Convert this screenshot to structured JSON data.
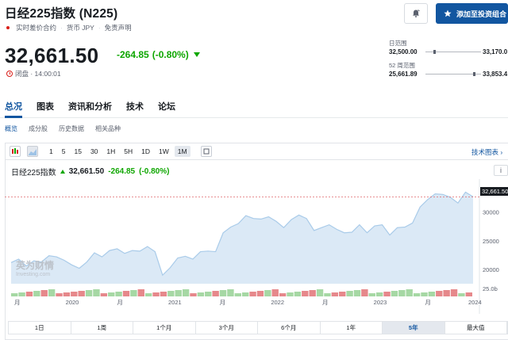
{
  "header": {
    "title": "日经225指数 (N225)",
    "meta": [
      "实时差价合约",
      "货币 JPY",
      "免责声明"
    ],
    "add_button": "添加至投资组合",
    "price": "32,661.50",
    "change": "-264.85",
    "change_pct": "(-0.80%)",
    "status": "闭盘 · 14:00:01"
  },
  "ranges": {
    "day_label": "日范围",
    "day_low": "32,500.00",
    "day_high": "33,170.0",
    "wk52_label": "52 周范围",
    "wk52_low": "25,661.89",
    "wk52_high": "33,853.4"
  },
  "tabs": [
    "总况",
    "图表",
    "资讯和分析",
    "技术",
    "论坛"
  ],
  "subtabs": [
    "概览",
    "成分股",
    "历史数据",
    "相关品种"
  ],
  "toolbar": {
    "intervals": [
      "1",
      "5",
      "15",
      "30",
      "1H",
      "5H",
      "1D",
      "1W",
      "1M"
    ],
    "active_interval": "1M",
    "tech_link": "技术图表 ›"
  },
  "chart_legend": {
    "name": "日经225指数",
    "value": "32,661.50",
    "change": "-264.85",
    "change_pct": "(-0.80%)"
  },
  "watermark": {
    "main": "英为财情",
    "sub": "Investing.com"
  },
  "price_tag": "32,661.50",
  "periods": [
    "1日",
    "1周",
    "1个月",
    "3个月",
    "6个月",
    "1年",
    "5年",
    "最大值"
  ],
  "active_period": "5年",
  "chart_data": {
    "type": "area",
    "series": [
      {
        "values": [
          21200,
          21800,
          20600,
          21500,
          21300,
          22400,
          22200,
          21600,
          20800,
          20200,
          21300,
          22900,
          22200,
          23300,
          23600,
          22800,
          23300,
          23200,
          24000,
          23100,
          19000,
          20300,
          22000,
          22300,
          21800,
          23100,
          23200,
          23100,
          26400,
          27400,
          28000,
          29400,
          28900,
          28800,
          29200,
          28400,
          27300,
          28700,
          29500,
          28900,
          26800,
          27300,
          27800,
          27000,
          26400,
          26500,
          27800,
          26400,
          27600,
          27800,
          26000,
          27300,
          27400,
          28100,
          30900,
          32200,
          33200,
          33100,
          32600,
          31600,
          33500,
          32700
        ]
      }
    ],
    "volume_bars": 62,
    "x_tick_labels": [
      "月",
      "2020",
      "月",
      "2021",
      "月",
      "2022",
      "月",
      "2023",
      "月",
      "2024"
    ],
    "y_ticks": [
      20000,
      25000,
      30000
    ],
    "y_tick_labels": [
      "20000",
      "25000",
      "30000"
    ],
    "volume_label": "25.0b",
    "ylim": [
      17500,
      35500
    ],
    "last_value": 32661.5
  }
}
